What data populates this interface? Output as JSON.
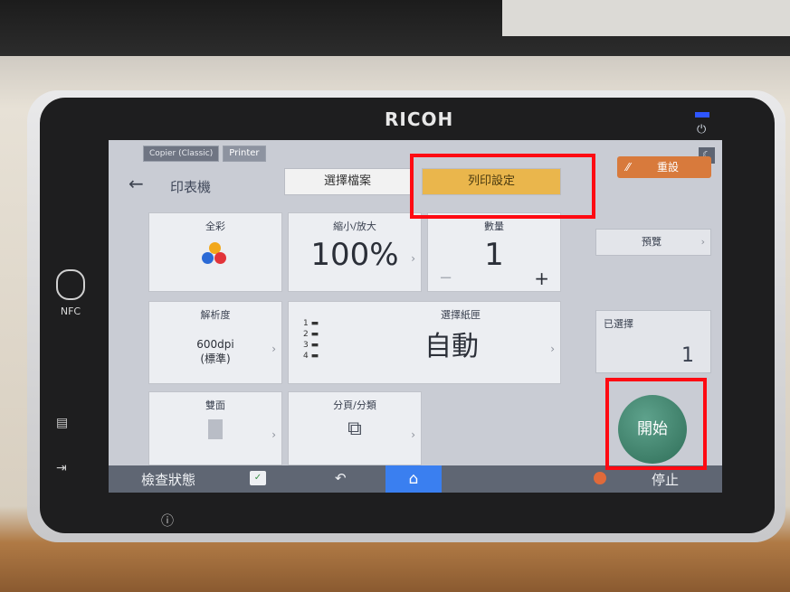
{
  "device": {
    "brand": "RICOH",
    "nfc_label": "NFC"
  },
  "tabs": [
    {
      "label": "Copier (Classic)"
    },
    {
      "label": "Printer"
    }
  ],
  "header": {
    "title": "印表機",
    "select_file": "選擇檔案",
    "print_settings": "列印設定",
    "reset": "重設"
  },
  "tiles": {
    "color": {
      "label": "全彩"
    },
    "zoom": {
      "label": "縮小/放大",
      "value": "100%"
    },
    "quantity": {
      "label": "數量",
      "value": "1",
      "minus": "−",
      "plus": "+"
    },
    "resolution": {
      "label": "解析度",
      "value": "600dpi",
      "sub": "(標準)"
    },
    "paper_tray": {
      "label": "選擇紙匣",
      "value": "自動",
      "trays": [
        "1",
        "2",
        "3",
        "4"
      ]
    },
    "duplex": {
      "label": "雙面"
    },
    "sort": {
      "label": "分頁/分類"
    }
  },
  "right": {
    "preview": "預覽",
    "selected_label": "已選擇",
    "selected_count": "1",
    "start": "開始"
  },
  "bottom": {
    "check_status": "檢查狀態",
    "stop": "停止"
  },
  "colors": {
    "accent": "#eab64c",
    "reset": "#d87a3c",
    "start": "#3f8a72",
    "home": "#3a7ff0",
    "highlight": "#ff0a12"
  }
}
